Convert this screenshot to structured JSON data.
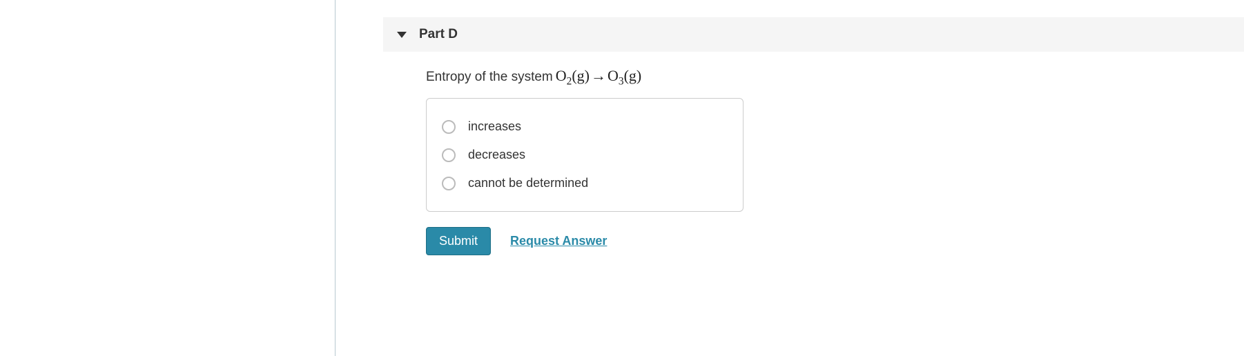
{
  "part": {
    "label": "Part D",
    "question_prefix": "Entropy of the system ",
    "formula": {
      "reactant_base": "O",
      "reactant_sub": "2",
      "reactant_state": "(g)",
      "product_base": "O",
      "product_sub": "3",
      "product_state": "(g)"
    },
    "options": [
      {
        "label": "increases"
      },
      {
        "label": "decreases"
      },
      {
        "label": "cannot be determined"
      }
    ],
    "submit_label": "Submit",
    "request_answer_label": "Request Answer"
  }
}
